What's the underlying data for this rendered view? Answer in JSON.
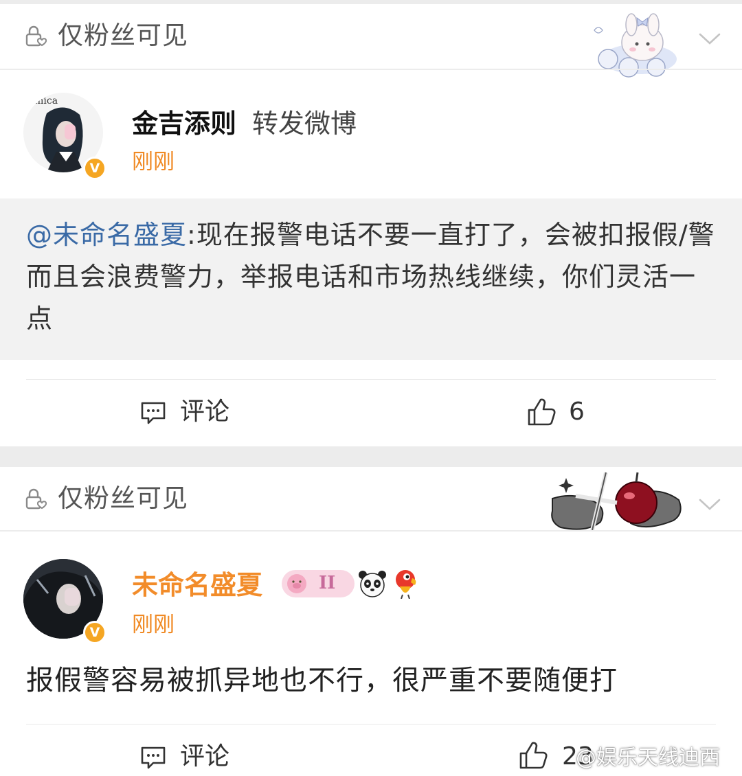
{
  "post1": {
    "visibility_label": "仅粉丝可见",
    "author_name": "金吉添则",
    "action": "转发微博",
    "time": "刚刚",
    "avatar_text": "Amica",
    "verified_mark": "V",
    "quote_mention": "@未命名盛夏",
    "quote_body": ":现在报警电话不要一直打了，会被扣报假/警而且会浪费警力，举报电话和市场热线继续，你们灵活一点",
    "comment_label": "评论",
    "like_count": "6"
  },
  "post2": {
    "visibility_label": "仅粉丝可见",
    "author_name": "未命名盛夏",
    "time": "刚刚",
    "verified_mark": "V",
    "badge_text": "II",
    "body": "报假警容易被抓异地也不行，很严重不要随便打",
    "comment_label": "评论",
    "like_count": "23"
  },
  "watermark": "@娱乐天线迪西",
  "colors": {
    "time_orange": "#f08a24",
    "mention_blue": "#3a6aa6",
    "verified_badge": "#f5a623",
    "quote_bg": "#f2f2f2"
  },
  "icons": [
    "lock-heart-icon",
    "chevron-down-icon",
    "comment-icon",
    "thumb-up-icon",
    "verified-icon",
    "panda-emoji-icon",
    "parrot-emoji-icon"
  ]
}
